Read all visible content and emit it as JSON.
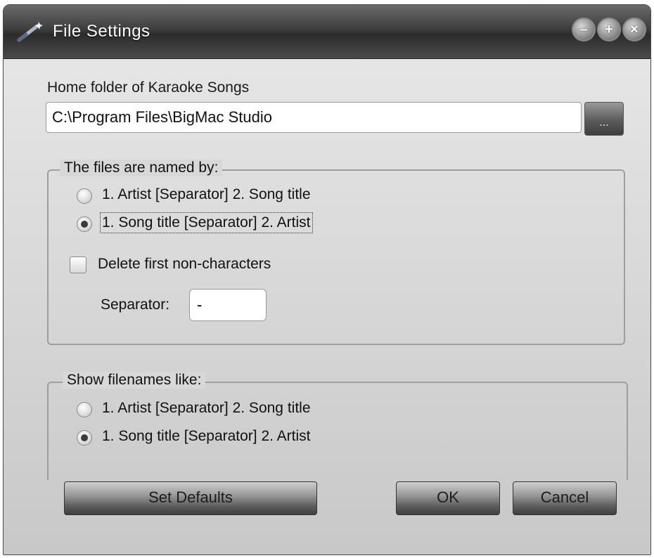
{
  "window": {
    "title": "File Settings",
    "minimize": "–",
    "maximize": "+",
    "close": "×"
  },
  "home_folder": {
    "label": "Home folder of Karaoke Songs",
    "value": "C:\\Program Files\\BigMac Studio",
    "browse_label": "..."
  },
  "naming_group": {
    "legend": "The files are named by:",
    "options": [
      "1. Artist [Separator] 2. Song title",
      "1. Song title  [Separator] 2. Artist"
    ],
    "selected_index": 1,
    "delete_first_label": "Delete first non-characters",
    "delete_first_checked": false,
    "separator_label": "Separator:",
    "separator_value": "-"
  },
  "show_group": {
    "legend": "Show filenames like:",
    "options": [
      "1. Artist [Separator] 2. Song title",
      "1. Song title  [Separator] 2. Artist"
    ],
    "selected_index": 1
  },
  "buttons": {
    "defaults": "Set Defaults",
    "ok": "OK",
    "cancel": "Cancel"
  }
}
